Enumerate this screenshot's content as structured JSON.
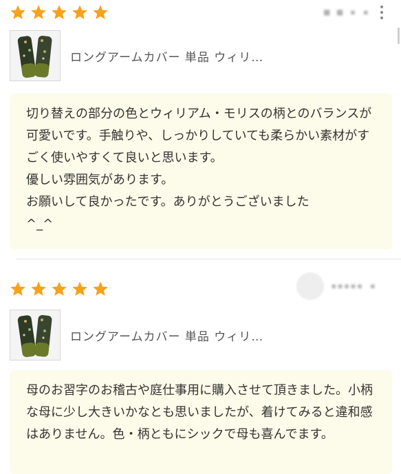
{
  "reviews": [
    {
      "rating": 5,
      "username": "■ ■   ▪ ▪",
      "product_name": "ロングアームカバー 単品 ウィリ…",
      "comment": "切り替えの部分の色とウィリアム・モリスの柄とのバランスが可愛いです。手触りや、しっかりしていても柔らかい素材がすごく使いやすくて良いと思います。\n優しい雰囲気があります。\nお願いして良かったです。ありがとうございました\n^_^"
    },
    {
      "rating": 5,
      "username": "▪▪▪▪▪  ▪",
      "product_name": "ロングアームカバー 単品 ウィリ…",
      "comment": "母のお習字のお稽古や庭仕事用に購入させて頂きました。小柄な母に少し大きいかなとも思いましたが、着けてみると違和感はありません。色・柄ともにシックで母も喜んでます。"
    }
  ],
  "colors": {
    "star": "#f7a21b",
    "comment_bg": "#fdfbe9",
    "fabric_green": "#6b7a2a",
    "fabric_dark": "#2e3a24"
  }
}
